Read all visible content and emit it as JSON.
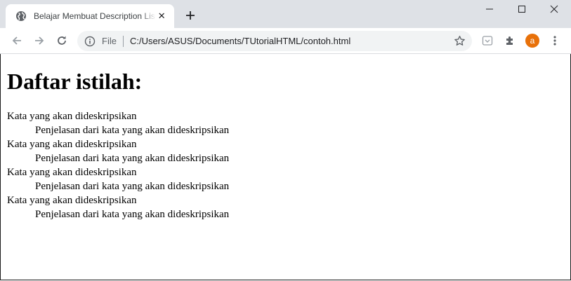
{
  "browser": {
    "tab_title": "Belajar Membuat Description List",
    "tab_close": "✕",
    "omnibox": {
      "scheme_label": "File",
      "url": "C:/Users/ASUS/Documents/TUtorialHTML/contoh.html"
    },
    "profile_initial": "a",
    "colors": {
      "tabstrip": "#dee1e6",
      "omnibox": "#f1f3f4",
      "avatar": "#e8710a"
    },
    "icons": {
      "tab": "globe-icon",
      "new_tab": "plus-icon",
      "minimize": "minimize-icon",
      "maximize": "maximize-icon",
      "close": "close-icon",
      "back": "arrow-back-icon",
      "forward": "arrow-forward-icon",
      "reload": "reload-icon",
      "info": "info-icon",
      "bookmark": "star-icon",
      "pocket": "pocket-icon",
      "extensions": "puzzle-icon",
      "menu": "kebab-menu-icon"
    }
  },
  "page": {
    "heading": "Daftar istilah:",
    "items": [
      {
        "term": "Kata yang akan dideskripsikan",
        "description": "Penjelasan dari kata yang akan dideskripsikan"
      },
      {
        "term": "Kata yang akan dideskripsikan",
        "description": "Penjelasan dari kata yang akan dideskripsikan"
      },
      {
        "term": "Kata yang akan dideskripsikan",
        "description": "Penjelasan dari kata yang akan dideskripsikan"
      },
      {
        "term": "Kata yang akan dideskripsikan",
        "description": "Penjelasan dari kata yang akan dideskripsikan"
      }
    ]
  }
}
